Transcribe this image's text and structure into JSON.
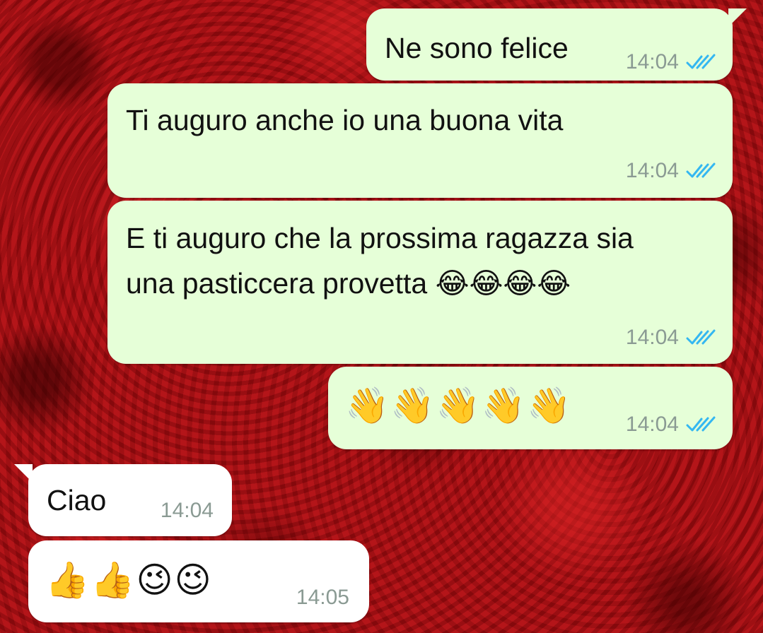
{
  "theme": {
    "outgoing_bubble": "#e6ffd8",
    "incoming_bubble": "#ffffff",
    "timestamp_color": "#8a9a93",
    "read_tick_color": "#34b7f1",
    "wallpaper": "red roses"
  },
  "messages": [
    {
      "direction": "outgoing",
      "text": "Ne sono felice",
      "time": "14:04",
      "status": "read",
      "status_icon": "double-check-icon"
    },
    {
      "direction": "outgoing",
      "text": "Ti auguro anche io una buona vita",
      "time": "14:04",
      "status": "read",
      "status_icon": "double-check-icon"
    },
    {
      "direction": "outgoing",
      "text": "E ti auguro che la prossima ragazza sia\nuna pasticcera provetta 😂😂😂😂",
      "time": "14:04",
      "status": "read",
      "status_icon": "double-check-icon"
    },
    {
      "direction": "outgoing",
      "text": "👋👋👋👋👋",
      "time": "14:04",
      "status": "read",
      "status_icon": "double-check-icon"
    },
    {
      "direction": "incoming",
      "text": "Ciao",
      "time": "14:04"
    },
    {
      "direction": "incoming",
      "text": "👍👍😉😉",
      "time": "14:05"
    }
  ]
}
